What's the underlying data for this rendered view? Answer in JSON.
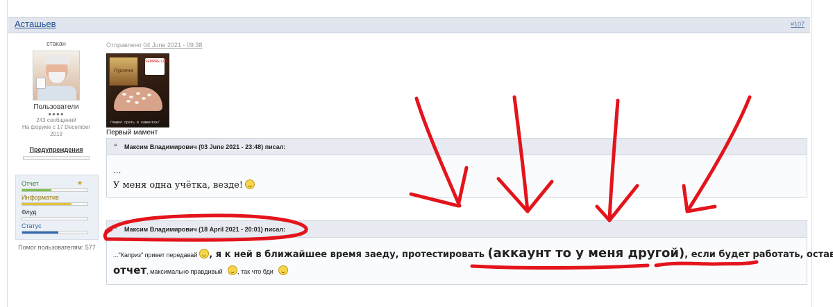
{
  "post": {
    "author": "Асташьев",
    "number": "#107",
    "posted_prefix": "Отправлено",
    "posted_date": "04 June 2021 - 09:38"
  },
  "user": {
    "title": "стакан",
    "group": "Пользователи",
    "rank_dots": "●●●●",
    "posts": "243 сообщений",
    "joined": "На форуме с 17 December 2019",
    "warnings_label": "Предупреждения",
    "helped": "Помог пользователям: 577",
    "reputation": [
      {
        "label": "Отчет",
        "color": "#3c7a2f",
        "fill": 0.45,
        "fillcolor": "#7cc14c"
      },
      {
        "label": "Информатив",
        "color": "#9a7a0a",
        "fill": 0.75,
        "fillcolor": "#e3c23b"
      },
      {
        "label": "Флуд",
        "color": "#222222",
        "fill": 0.0,
        "fillcolor": "#999999"
      },
      {
        "label": "Статус",
        "color": "#2f68b0",
        "fill": 0.55,
        "fillcolor": "#2f68b0"
      }
    ]
  },
  "signature": {
    "pack_label": "Пургена",
    "caption": "/пашел срать в каментах/",
    "badge": "SEMPRE.COM"
  },
  "first_moment": "Первый мамент",
  "quote1": {
    "header": "Максим Владимирович (03 June 2021 - 23:48) писал:",
    "line1": "...",
    "line2": "У меня одна учётка, везде!"
  },
  "quote2": {
    "header": "Максим Владимирович (18 April 2021 - 20:01) писал:",
    "part1": "...\"Каприз\" привет передавай",
    "part2": ", я к ней в ближайшее время заеду, протестировать",
    "part3": "(аккаунт то у меня другой)",
    "part4": ", если будет работать, оставлю",
    "part5": "отчет",
    "part6": ", максимально правдивый",
    "part7": ", так что бди"
  }
}
